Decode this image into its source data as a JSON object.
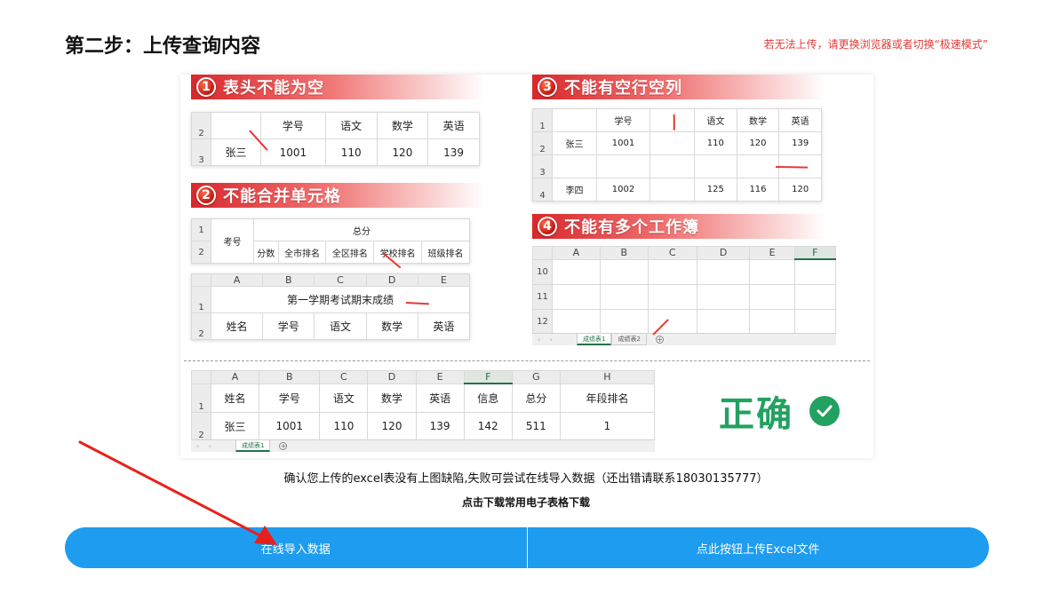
{
  "header": {
    "step_title": "第二步：上传查询内容",
    "notice": "若无法上传，请更换浏览器或者切换“极速模式”"
  },
  "illustration": {
    "rules": [
      {
        "num": "1",
        "text": "表头不能为空"
      },
      {
        "num": "2",
        "text": "不能合并单元格"
      },
      {
        "num": "3",
        "text": "不能有空行空列"
      },
      {
        "num": "4",
        "text": "不能有多个工作簿"
      }
    ],
    "t1": {
      "rows": [
        "2",
        "3"
      ],
      "headers": [
        "",
        "学号",
        "语文",
        "数学",
        "英语"
      ],
      "values": [
        "张三",
        "1001",
        "110",
        "120",
        "139"
      ]
    },
    "t2a": {
      "rows": [
        "1",
        "2"
      ],
      "kaohao": "考号",
      "zongfen": "总分",
      "subs": [
        "分数",
        "全市排名",
        "全区排名",
        "学校排名",
        "班级排名"
      ]
    },
    "t2b": {
      "cols": [
        "A",
        "B",
        "C",
        "D",
        "E"
      ],
      "rows": [
        "1",
        "2"
      ],
      "title": "第一学期考试期末成绩",
      "headers": [
        "姓名",
        "学号",
        "语文",
        "数学",
        "英语"
      ]
    },
    "t3": {
      "rows": [
        "1",
        "2",
        "3",
        "4"
      ],
      "headers": [
        "",
        "学号",
        "",
        "语文",
        "数学",
        "英语"
      ],
      "r2": [
        "张三",
        "1001",
        "",
        "110",
        "120",
        "139"
      ],
      "r4": [
        "李四",
        "1002",
        "",
        "125",
        "116",
        "120"
      ]
    },
    "t4": {
      "cols": [
        "A",
        "B",
        "C",
        "D",
        "E",
        "F"
      ],
      "rows": [
        "10",
        "11",
        "12"
      ],
      "tabs": [
        "成绩表1",
        "成绩表2"
      ]
    },
    "t5": {
      "cols": [
        "A",
        "B",
        "C",
        "D",
        "E",
        "F",
        "G",
        "H"
      ],
      "rows": [
        "1",
        "2"
      ],
      "headers": [
        "姓名",
        "学号",
        "语文",
        "数学",
        "英语",
        "信息",
        "总分",
        "年段排名"
      ],
      "values": [
        "张三",
        "1001",
        "110",
        "120",
        "139",
        "142",
        "511",
        "1"
      ],
      "tab": "成绩表1"
    },
    "correct": "正确"
  },
  "confirm_text": "确认您上传的excel表没有上图缺陷,失败可尝试在线导入数据（还出错请联系18030135777）",
  "download_link": "点击下载常用电子表格下载",
  "buttons": {
    "online_import": "在线导入数据",
    "upload_excel": "点此按钮上传Excel文件"
  },
  "colors": {
    "button_blue": "#1e9cef",
    "notice_red": "#e53935",
    "correct_green": "#22a160",
    "excel_green": "#217346"
  },
  "icons": [
    "check-icon",
    "red-arrow-icon"
  ]
}
